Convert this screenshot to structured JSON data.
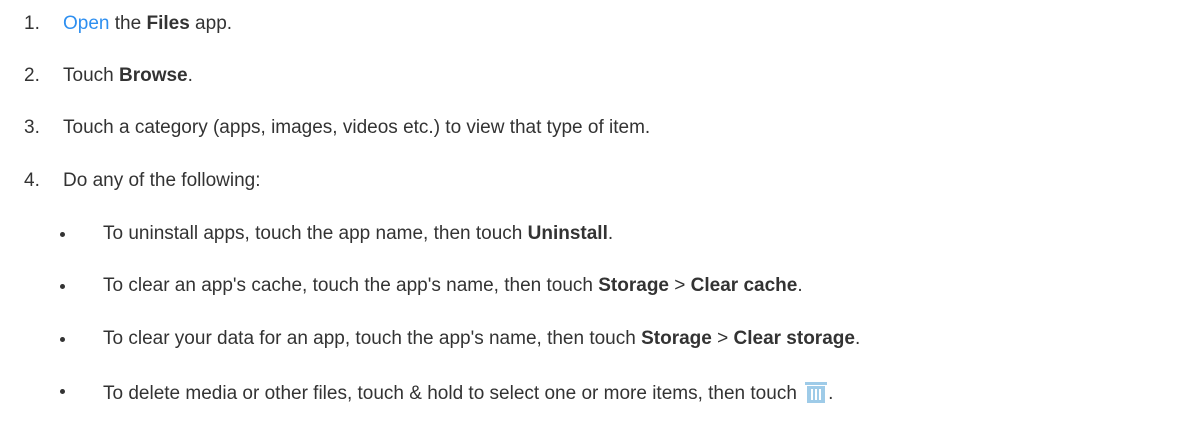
{
  "steps": [
    {
      "num": "1.",
      "pre": "",
      "link": "Open",
      "mid": " the ",
      "bold": "Files",
      "post": " app."
    },
    {
      "num": "2.",
      "pre": "Touch ",
      "bold": "Browse",
      "post": "."
    },
    {
      "num": "3.",
      "text": "Touch a category (apps, images, videos etc.) to view that type of item."
    },
    {
      "num": "4.",
      "text": "Do any of the following:"
    }
  ],
  "bullets": [
    {
      "pre": "To uninstall apps, touch the app name, then touch ",
      "bold1": "Uninstall",
      "post": "."
    },
    {
      "pre": "To clear an app's cache, touch the app's name, then touch ",
      "bold1": "Storage",
      "sep": " > ",
      "bold2": "Clear cache",
      "post": "."
    },
    {
      "pre": "To clear your data for an app, touch the app's name, then touch ",
      "bold1": "Storage",
      "sep": " > ",
      "bold2": "Clear storage",
      "post": "."
    },
    {
      "pre": "To delete media or other files, touch & hold to select one or more items, then touch ",
      "icon": "trash-icon",
      "post": "."
    }
  ],
  "colors": {
    "link": "#2e8ff0",
    "text": "#333333",
    "icon": "#9ecbe8"
  }
}
